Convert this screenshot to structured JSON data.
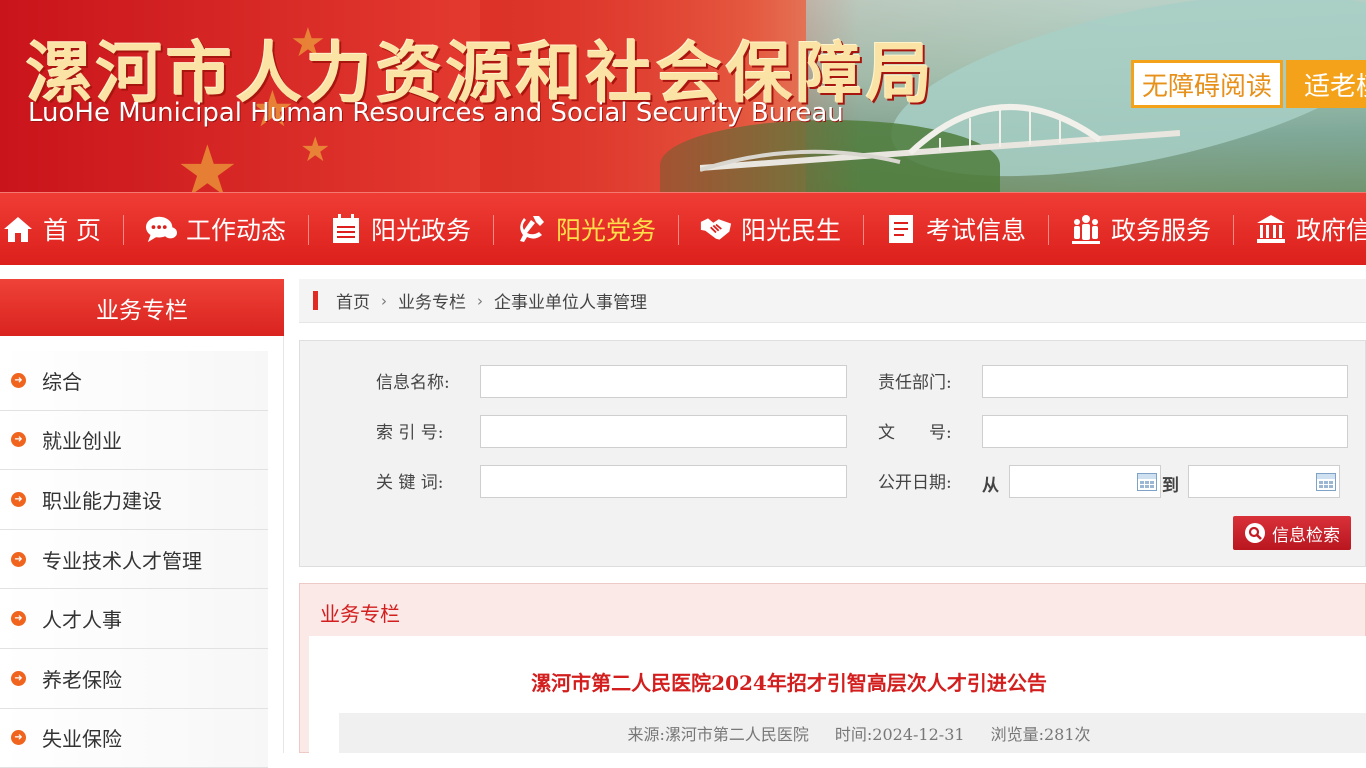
{
  "banner": {
    "title_cn": "漯河市人力资源和社会保障局",
    "title_en": "LuoHe Municipal Human Resources and Social Security Bureau",
    "accessibility_label": "无障碍阅读",
    "elder_mode_label": "适老模式"
  },
  "nav": {
    "items": [
      {
        "label": "首 页",
        "icon": "home-icon"
      },
      {
        "label": "工作动态",
        "icon": "chat-icon"
      },
      {
        "label": "阳光政务",
        "icon": "calendar-icon"
      },
      {
        "label": "阳光党务",
        "icon": "party-icon"
      },
      {
        "label": "阳光民生",
        "icon": "handshake-icon"
      },
      {
        "label": "考试信息",
        "icon": "document-icon"
      },
      {
        "label": "政务服务",
        "icon": "people-icon"
      },
      {
        "label": "政府信息",
        "icon": "building-icon"
      }
    ],
    "active_index": 3,
    "active_color": "#ffe04a"
  },
  "sidebar": {
    "heading": "业务专栏",
    "items": [
      {
        "label": "综合"
      },
      {
        "label": "就业创业"
      },
      {
        "label": "职业能力建设"
      },
      {
        "label": "专业技术人才管理"
      },
      {
        "label": "人才人事"
      },
      {
        "label": "养老保险"
      },
      {
        "label": "失业保险"
      }
    ]
  },
  "breadcrumb": {
    "items": [
      "首页",
      "业务专栏",
      "企事业单位人事管理"
    ]
  },
  "search": {
    "info_name_label": "信息名称:",
    "dept_label": "责任部门:",
    "index_label": "索 引 号:",
    "doc_no_label": "文　　号:",
    "keyword_label": "关 键 词:",
    "date_label": "公开日期:",
    "from_label": "从",
    "to_label": "到",
    "button_label": "信息检索"
  },
  "content": {
    "section_title": "业务专栏",
    "article_title": "漯河市第二人民医院2024年招才引智高层次人才引进公告",
    "source": "来源:漯河市第二人民医院",
    "time": "时间:2024-12-31",
    "views": "浏览量:281次"
  },
  "colors": {
    "brand_red": "#dc1f1c",
    "accent_orange": "#f5a21b",
    "title_red": "#d31e1e"
  }
}
